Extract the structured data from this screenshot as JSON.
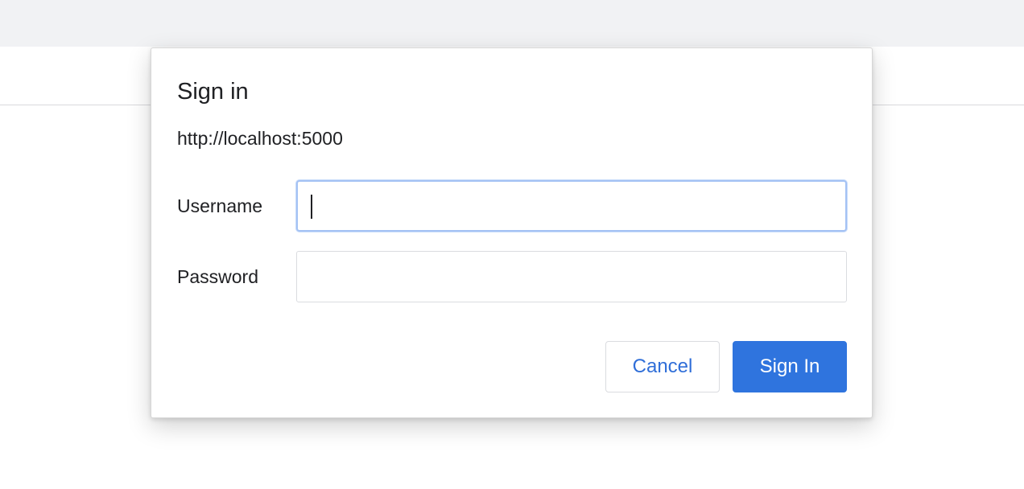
{
  "dialog": {
    "title": "Sign in",
    "origin": "http://localhost:5000",
    "username": {
      "label": "Username",
      "value": "",
      "focused": true
    },
    "password": {
      "label": "Password",
      "value": ""
    },
    "buttons": {
      "cancel": "Cancel",
      "sign_in": "Sign In"
    },
    "colors": {
      "primary": "#2f74de",
      "cancel_text": "#2f6ed8",
      "focus_ring": "#a4c2f4"
    }
  }
}
